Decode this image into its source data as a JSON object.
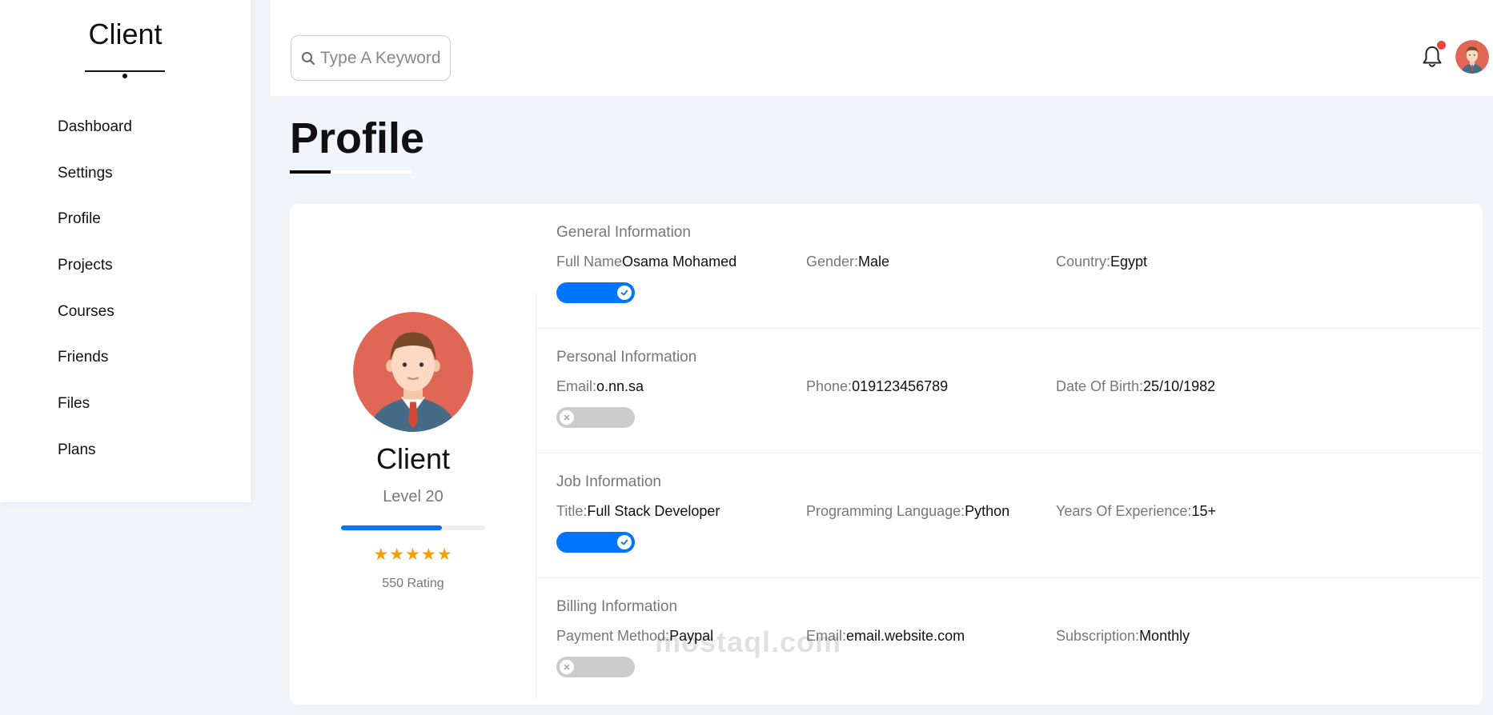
{
  "sidebar": {
    "brand": "Client",
    "items": [
      {
        "label": "Dashboard"
      },
      {
        "label": "Settings"
      },
      {
        "label": "Profile"
      },
      {
        "label": "Projects"
      },
      {
        "label": "Courses"
      },
      {
        "label": "Friends"
      },
      {
        "label": "Files"
      },
      {
        "label": "Plans"
      }
    ]
  },
  "header": {
    "search_placeholder": "Type A Keyword",
    "notification_indicator_color": "#f44336"
  },
  "page": {
    "title": "Profile"
  },
  "profile": {
    "name": "Client",
    "level": "Level 20",
    "level_progress": 0.7,
    "stars": "★★★★★",
    "rating_count": 5,
    "rating": "550 Rating"
  },
  "sections": {
    "general": {
      "title": "General Information",
      "f1": {
        "label": "Full Name",
        "value": "Osama Mohamed"
      },
      "f2": {
        "label": "Gender:",
        "value": "Male"
      },
      "f3": {
        "label": "Country:",
        "value": "Egypt"
      },
      "toggle_on": true
    },
    "personal": {
      "title": "Personal Information",
      "f1": {
        "label": "Email:",
        "value": "o.nn.sa"
      },
      "f2": {
        "label": "Phone:",
        "value": "019123456789"
      },
      "f3": {
        "label": "Date Of Birth:",
        "value": "25/10/1982"
      },
      "toggle_on": false
    },
    "job": {
      "title": "Job Information",
      "f1": {
        "label": "Title:",
        "value": "Full Stack Developer"
      },
      "f2": {
        "label": "Programming Language:",
        "value": "Python"
      },
      "f3": {
        "label": "Years Of Experience:",
        "value": "15+"
      },
      "toggle_on": true
    },
    "billing": {
      "title": "Billing Information",
      "f1": {
        "label": "Payment Method:",
        "value": "Paypal"
      },
      "f2": {
        "label": "Email:",
        "value": "email.website.com"
      },
      "f3": {
        "label": "Subscription:",
        "value": "Monthly"
      },
      "toggle_on": false
    }
  },
  "watermark": "mostaql.com",
  "colors": {
    "accent": "#0075ff",
    "star": "#f59e0b",
    "background": "#f1f5f9",
    "avatar_bg": "#e06655"
  }
}
